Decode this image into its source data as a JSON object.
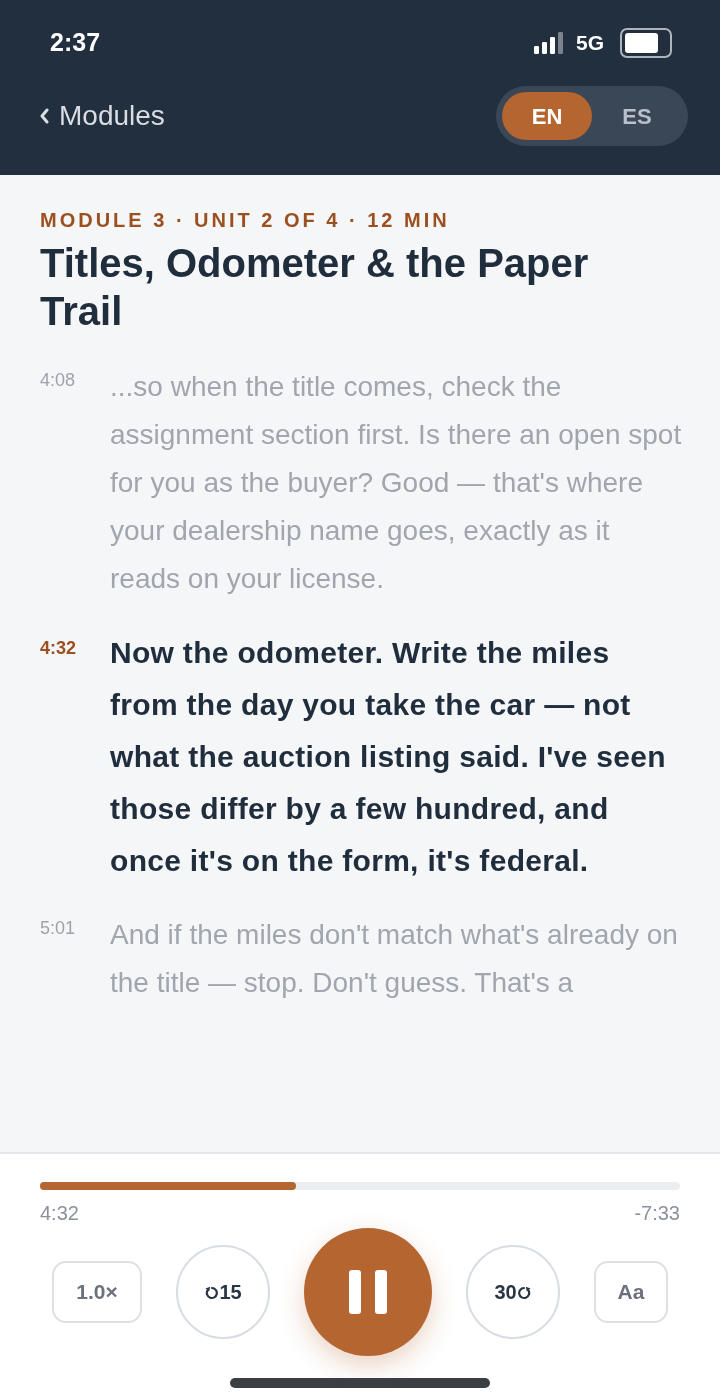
{
  "status_bar": {
    "time": "2:37",
    "network": "5G"
  },
  "nav": {
    "back_label": "Modules",
    "languages": [
      {
        "label": "EN",
        "selected": true
      },
      {
        "label": "ES",
        "selected": false
      }
    ]
  },
  "lesson": {
    "eyebrow": "MODULE 3 · UNIT 2 OF 4 · 12 MIN",
    "title": "Titles, Odometer & the Paper Trail"
  },
  "transcript": [
    {
      "time": "4:08",
      "text": "...so when the title comes, check the assignment section first. Is there an open spot for you as the buyer? Good — that's where your dealership name goes, exactly as it reads on your license.",
      "active": false
    },
    {
      "time": "4:32",
      "text": "Now the odometer. Write the miles from the day you take the car — not what the auction listing said. I've seen those differ by a few hundred, and once it's on the form, it's federal.",
      "active": true
    },
    {
      "time": "5:01",
      "text": "And if the miles don't match what's already on the title — stop. Don't guess. That's a",
      "active": false
    }
  ],
  "player": {
    "level": 0.4,
    "elapsed": "4:32",
    "remaining": "-7:33",
    "speed": "1.0×",
    "skip_back": "15",
    "skip_forward": "30",
    "playing": true,
    "text_size": "Aa"
  }
}
